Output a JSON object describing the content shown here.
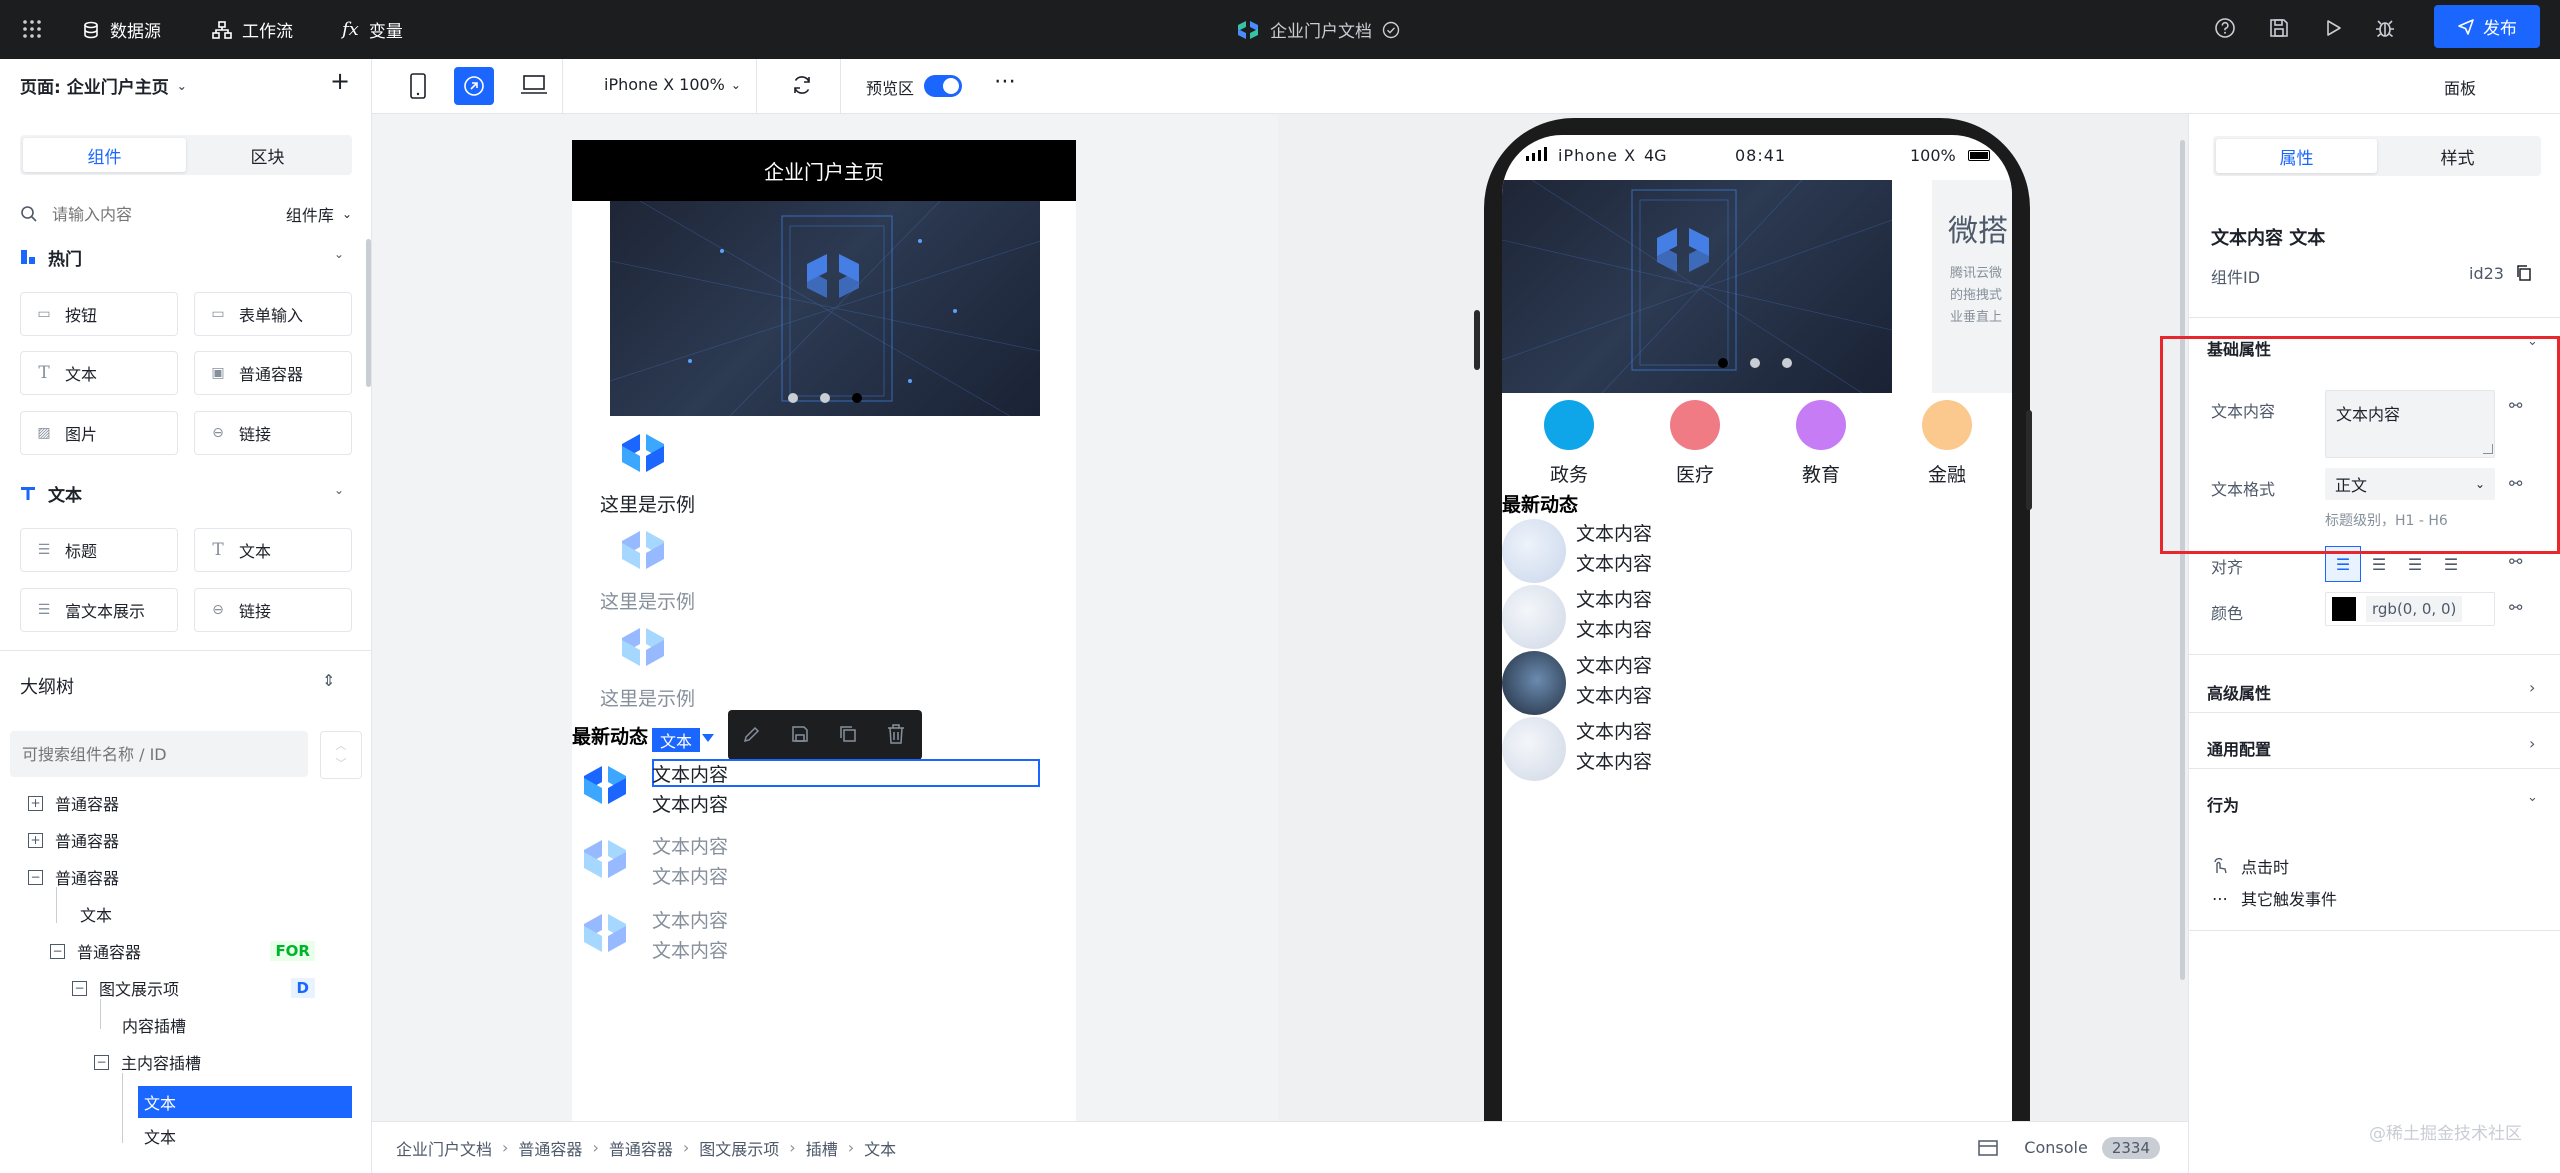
{
  "topbar": {
    "datasource": "数据源",
    "workflow": "工作流",
    "variables": "变量",
    "doc_title": "企业门户文档",
    "publish": "发布",
    "brand_color": "#1a66ff"
  },
  "sidebar": {
    "page_label": "页面: 企业门户主页",
    "tabs": [
      "组件",
      "区块"
    ],
    "search_placeholder": "请输入内容",
    "library": "组件库",
    "hot": {
      "title": "热门",
      "items": [
        "按钮",
        "表单输入",
        "文本",
        "普通容器",
        "图片",
        "链接"
      ]
    },
    "text": {
      "title": "文本",
      "items": [
        "标题",
        "文本",
        "富文本展示",
        "链接"
      ]
    },
    "outline": {
      "title": "大纲树",
      "search_placeholder": "可搜索组件名称 / ID",
      "rows": [
        {
          "label": "普通容器",
          "box": "+"
        },
        {
          "label": "普通容器",
          "box": "+"
        },
        {
          "label": "普通容器",
          "box": "−"
        },
        {
          "label": "文本",
          "box": ""
        },
        {
          "label": "普通容器",
          "box": "−",
          "tag": "FOR"
        },
        {
          "label": "图文展示项",
          "box": "−",
          "tag": "D"
        },
        {
          "label": "内容插槽",
          "box": ""
        },
        {
          "label": "主内容插槽",
          "box": "−"
        },
        {
          "label": "文本",
          "box": "",
          "selected": true
        },
        {
          "label": "文本",
          "box": ""
        }
      ]
    }
  },
  "toolbar": {
    "device": "iPhone X 100%",
    "preview": "预览区",
    "panel": "面板"
  },
  "page": {
    "header": "企业门户主页",
    "examples": [
      "这里是示例",
      "这里是示例",
      "这里是示例"
    ],
    "news_title": "最新动态",
    "tag": "文本",
    "items": [
      [
        "文本内容",
        "文本内容"
      ],
      [
        "文本内容",
        "文本内容"
      ],
      [
        "文本内容",
        "文本内容"
      ]
    ]
  },
  "phone": {
    "carrier": "iPhone X",
    "network": "4G",
    "time": "08:41",
    "battery": "100%",
    "side_title": "微搭",
    "side_lines": [
      "腾讯云微",
      "的拖拽式",
      "业垂直上"
    ],
    "categories": [
      {
        "label": "政务",
        "color": "#0ea5e9"
      },
      {
        "label": "医疗",
        "color": "#f07b85"
      },
      {
        "label": "教育",
        "color": "#c67cf5"
      },
      {
        "label": "金融",
        "color": "#fbc98e"
      }
    ],
    "news_title": "最新动态",
    "items": [
      [
        "文本内容",
        "文本内容"
      ],
      [
        "文本内容",
        "文本内容"
      ],
      [
        "文本内容",
        "文本内容"
      ],
      [
        "文本内容",
        "文本内容"
      ]
    ]
  },
  "rpanel": {
    "tabs": [
      "属性",
      "样式"
    ],
    "title": "文本内容 文本",
    "id_label": "组件ID",
    "id_value": "id23",
    "basic": "基础属性",
    "content_label": "文本内容",
    "content_value": "文本内容",
    "format_label": "文本格式",
    "format_value": "正文",
    "format_hint": "标题级别，H1 - H6",
    "align_label": "对齐",
    "color_label": "颜色",
    "color_value": "rgb(0, 0, 0)",
    "advanced": "高级属性",
    "general": "通用配置",
    "behavior": "行为",
    "on_click": "点击时",
    "other_events": "其它触发事件"
  },
  "bottombar": {
    "crumbs": [
      "企业门户文档",
      "普通容器",
      "普通容器",
      "图文展示项",
      "插槽",
      "文本"
    ],
    "console": "Console",
    "count": "2334"
  },
  "watermark": "@稀土掘金技术社区"
}
